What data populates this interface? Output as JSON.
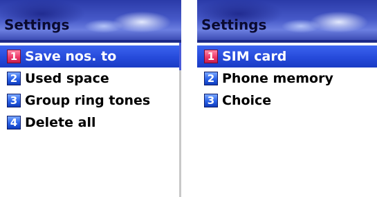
{
  "screens": [
    {
      "title": "Settings",
      "items": [
        {
          "num": "1",
          "label": "Save nos. to",
          "selected": true,
          "badge_color": "pink"
        },
        {
          "num": "2",
          "label": "Used space",
          "selected": false,
          "badge_color": "blue"
        },
        {
          "num": "3",
          "label": "Group ring tones",
          "selected": false,
          "badge_color": "blue"
        },
        {
          "num": "4",
          "label": "Delete all",
          "selected": false,
          "badge_color": "blue"
        }
      ]
    },
    {
      "title": "Settings",
      "items": [
        {
          "num": "1",
          "label": "SIM card",
          "selected": true,
          "badge_color": "pink"
        },
        {
          "num": "2",
          "label": "Phone memory",
          "selected": false,
          "badge_color": "blue"
        },
        {
          "num": "3",
          "label": "Choice",
          "selected": false,
          "badge_color": "blue"
        }
      ]
    }
  ],
  "colors": {
    "selection": "#2448d8",
    "title_bar": "#3a4cc0",
    "badge_blue": "#2a62e8",
    "badge_pink": "#ee3a6a"
  }
}
